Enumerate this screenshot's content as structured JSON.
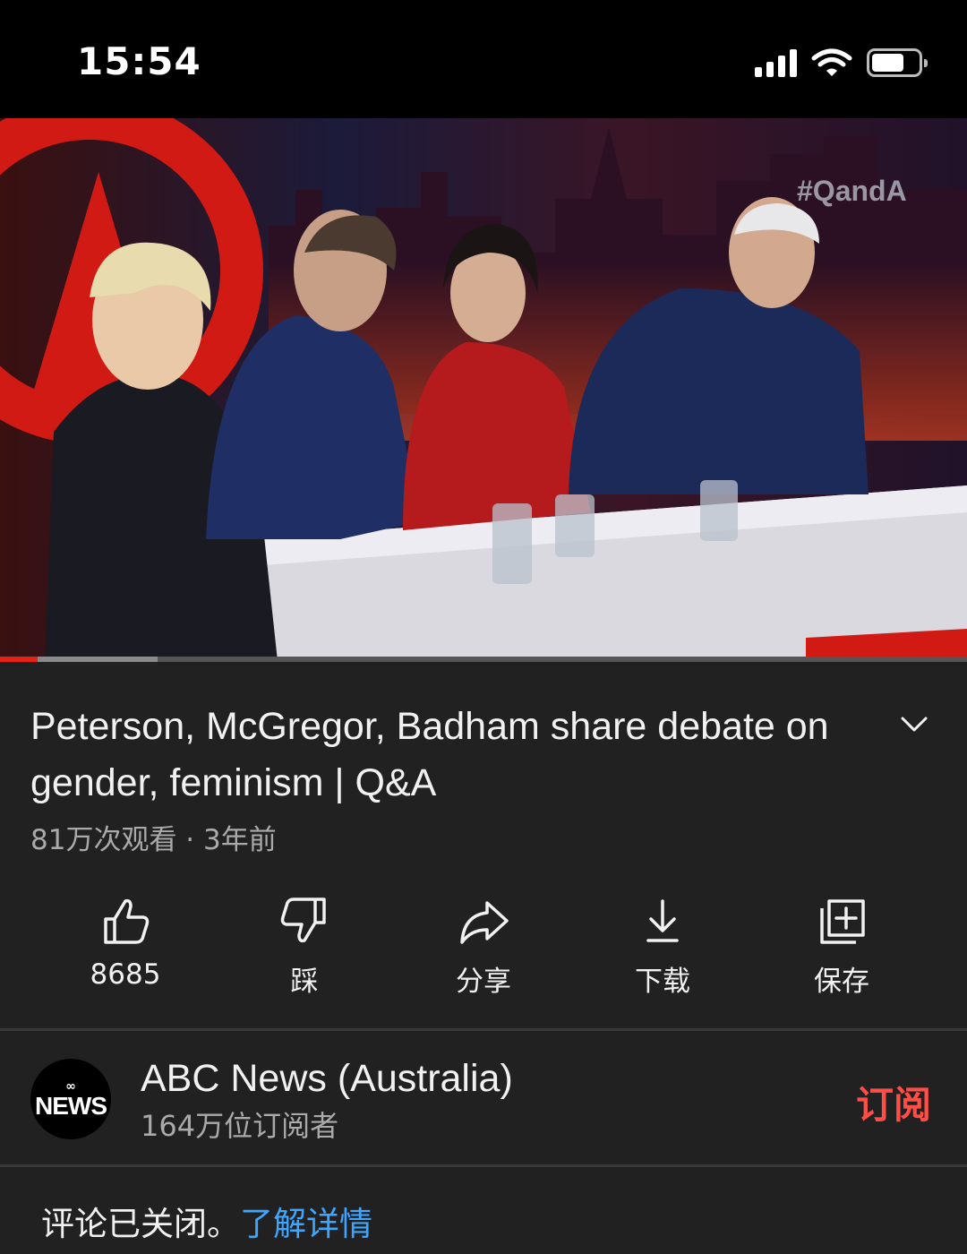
{
  "status_bar": {
    "time": "15:54"
  },
  "video": {
    "watermark": "#QandA",
    "progress_played_fraction": 0.039,
    "progress_buffered_fraction": 0.163
  },
  "title": "Peterson, McGregor, Badham share debate on gender, feminism | Q&A",
  "meta": "81万次观看 · 3年前",
  "actions": {
    "like_label": "8685",
    "dislike_label": "踩",
    "share_label": "分享",
    "download_label": "下载",
    "save_label": "保存"
  },
  "channel": {
    "avatar_text": "NEWS",
    "name": "ABC News (Australia)",
    "subscribers": "164万位订阅者",
    "subscribe_label": "订阅"
  },
  "comments": {
    "notice": "评论已关闭。",
    "link": "了解详情"
  },
  "colors": {
    "background": "#212121",
    "subscribe": "#ff4e45",
    "link": "#3ea6ff",
    "progress": "#e62117"
  }
}
